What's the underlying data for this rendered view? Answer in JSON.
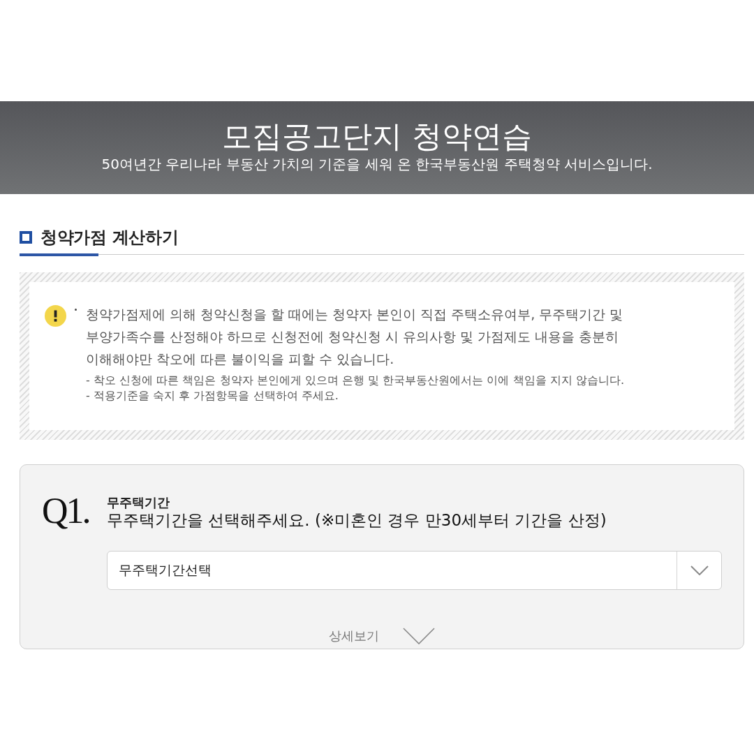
{
  "banner": {
    "title": "모집공고단지 청약연습",
    "subtitle": "50여년간 우리나라 부동산 가치의 기준을 세워 온 한국부동산원 주택청약 서비스입니다."
  },
  "section": {
    "heading": "청약가점 계산하기"
  },
  "notice": {
    "main": "청약가점제에 의해 청약신청을 할 때에는 청약자 본인이 직접 주택소유여부, 무주택기간 및 부양가족수를 산정해야 하므로 신청전에 청약신청 시 유의사항 및 가점제도 내용을 충분히 이해해야만 착오에 따른 불이익을 피할 수 있습니다.",
    "notes": [
      "- 착오 신청에 따른 책임은 청약자 본인에게 있으며 은행 및 한국부동산원에서는 이에 책임을 지지 않습니다.",
      "- 적용기준을 숙지 후 가점항목을 선택하여 주세요."
    ]
  },
  "questions": [
    {
      "number": "Q1.",
      "label": "무주택기간",
      "prompt": "무주택기간을 선택해주세요. (※미혼인 경우 만30세부터 기간을 산정)",
      "select": {
        "value": "무주택기간선택"
      },
      "details": {
        "label": "상세보기",
        "expanded": false
      }
    }
  ]
}
